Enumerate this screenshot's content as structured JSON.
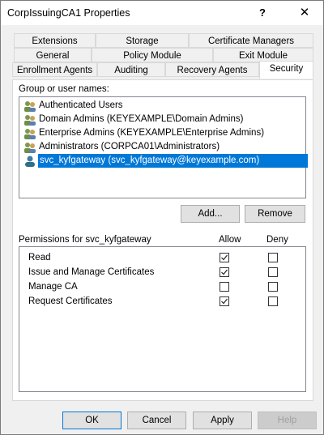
{
  "window": {
    "title": "CorpIssuingCA1 Properties",
    "help_glyph": "?",
    "close_glyph": "✕"
  },
  "tabs_row1": [
    "Extensions",
    "Storage",
    "Certificate Managers"
  ],
  "tabs_row2": [
    "General",
    "Policy Module",
    "Exit Module"
  ],
  "tabs_row3": [
    "Enrollment Agents",
    "Auditing",
    "Recovery Agents",
    "Security"
  ],
  "selected_tab": "Security",
  "groups": {
    "label": "Group or user names:",
    "items": [
      {
        "name": "Authenticated Users",
        "icon": "group-icon"
      },
      {
        "name": "Domain Admins (KEYEXAMPLE\\Domain Admins)",
        "icon": "group-icon"
      },
      {
        "name": "Enterprise Admins (KEYEXAMPLE\\Enterprise Admins)",
        "icon": "group-icon"
      },
      {
        "name": "Administrators (CORPCA01\\Administrators)",
        "icon": "group-icon"
      },
      {
        "name": "svc_kyfgateway (svc_kyfgateway@keyexample.com)",
        "icon": "user-icon",
        "selected": true
      }
    ]
  },
  "buttons": {
    "add": "Add...",
    "remove": "Remove",
    "ok": "OK",
    "cancel": "Cancel",
    "apply": "Apply",
    "help": "Help"
  },
  "permissions": {
    "label": "Permissions for svc_kyfgateway",
    "allow_header": "Allow",
    "deny_header": "Deny",
    "rows": [
      {
        "name": "Read",
        "allow": true,
        "deny": false
      },
      {
        "name": "Issue and Manage Certificates",
        "allow": true,
        "deny": false
      },
      {
        "name": "Manage CA",
        "allow": false,
        "deny": false
      },
      {
        "name": "Request Certificates",
        "allow": true,
        "deny": false
      }
    ]
  },
  "colors": {
    "selection": "#0078d7",
    "window_bg": "#f0f0f0"
  }
}
